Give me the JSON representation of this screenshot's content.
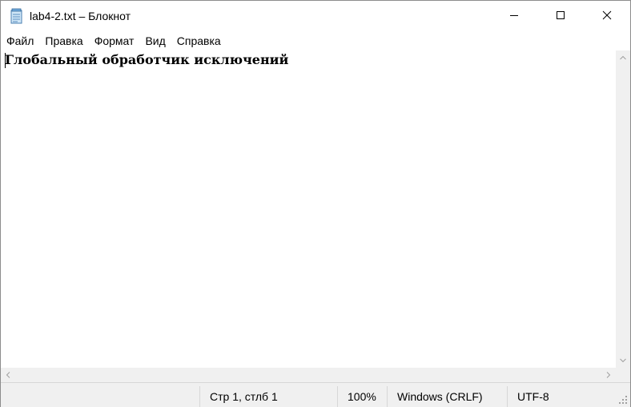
{
  "window": {
    "title": "lab4-2.txt – Блокнот",
    "icon": "notepad-icon"
  },
  "controls": {
    "minimize_icon": "minimize-icon",
    "maximize_icon": "maximize-icon",
    "close_icon": "close-icon"
  },
  "menu": {
    "items": [
      {
        "label": "Файл"
      },
      {
        "label": "Правка"
      },
      {
        "label": "Формат"
      },
      {
        "label": "Вид"
      },
      {
        "label": "Справка"
      }
    ]
  },
  "editor": {
    "content": "Глобальный обработчик исключений"
  },
  "statusbar": {
    "position": "Стр 1, стлб 1",
    "zoom": "100%",
    "line_ending": "Windows (CRLF)",
    "encoding": "UTF-8"
  },
  "colors": {
    "chrome": "#f0f0f0",
    "border": "#d7d7d7",
    "text": "#000000"
  }
}
